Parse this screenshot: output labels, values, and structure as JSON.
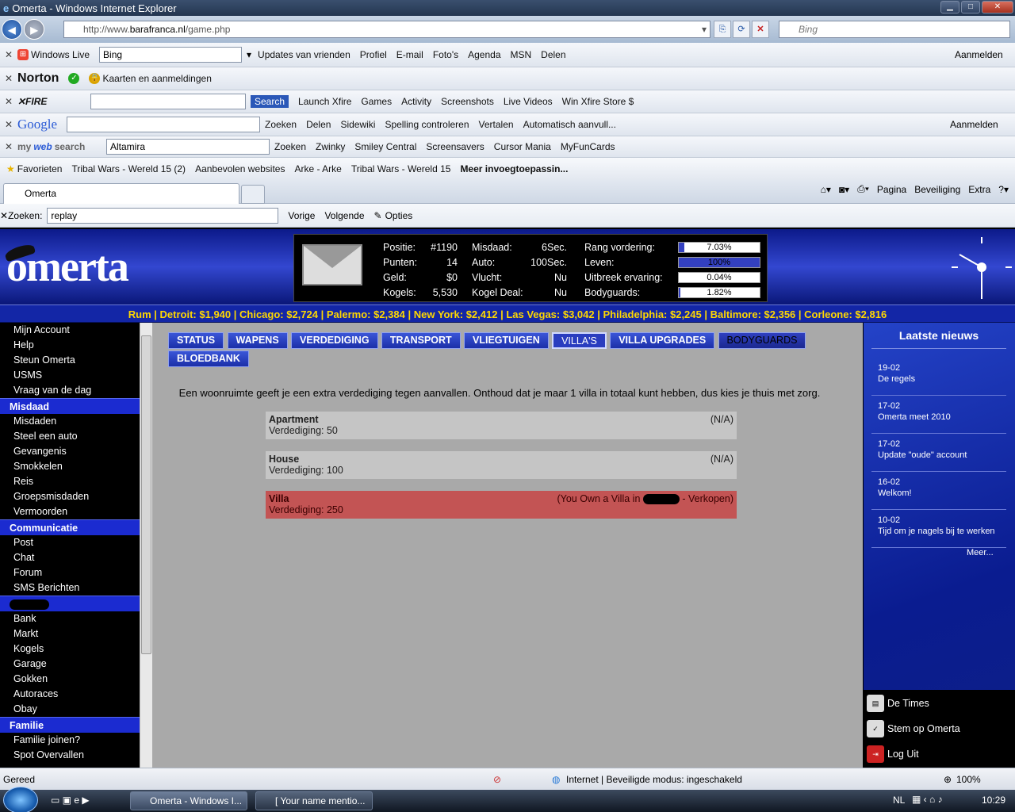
{
  "window": {
    "title": "Omerta - Windows Internet Explorer",
    "min": "▁",
    "max": "□",
    "close": "✕"
  },
  "address": {
    "url_prefix": "http://www.",
    "url_domain": "barafranca.nl",
    "url_path": "/game.php",
    "search_placeholder": "Bing"
  },
  "toolbars": {
    "windows_live": {
      "brand": "Windows Live",
      "search_value": "Bing",
      "items": [
        "Updates van vrienden",
        "Profiel",
        "E-mail",
        "Foto's",
        "Agenda",
        "MSN",
        "Delen"
      ],
      "signin": "Aanmelden"
    },
    "norton": {
      "brand": "Norton",
      "cards": "Kaarten en aanmeldingen"
    },
    "xfire": {
      "search": "Search",
      "items": [
        "Launch Xfire",
        "Games",
        "Activity",
        "Screenshots",
        "Live Videos",
        "Win Xfire Store $"
      ]
    },
    "google": {
      "brand": "Google",
      "items": [
        "Zoeken",
        "Delen",
        "Sidewiki",
        "Spelling controleren",
        "Vertalen",
        "Automatisch aanvull..."
      ],
      "signin": "Aanmelden"
    },
    "mywebsearch": {
      "brand_a": "my",
      "brand_b": "web",
      "brand_c": "search",
      "value": "Altamira",
      "items": [
        "Zoeken",
        "Zwinky",
        "Smiley Central",
        "Screensavers",
        "Cursor Mania",
        "MyFunCards"
      ]
    }
  },
  "favorites": {
    "label": "Favorieten",
    "items": [
      "Tribal Wars - Wereld 15 (2)",
      "Aanbevolen websites",
      "Arke - Arke",
      "Tribal Wars - Wereld 15",
      "Meer invoegtoepassin..."
    ]
  },
  "tab": {
    "title": "Omerta"
  },
  "commandbar": [
    "Pagina",
    "Beveiliging",
    "Extra"
  ],
  "find": {
    "label": "Zoeken:",
    "value": "replay",
    "prev": "Vorige",
    "next": "Volgende",
    "options": "Opties"
  },
  "game": {
    "logo": "omerta",
    "stats": [
      {
        "label": "Positie:",
        "value": "#1190"
      },
      {
        "label": "Punten:",
        "value": "14"
      },
      {
        "label": "Geld:",
        "value": "$0"
      },
      {
        "label": "Kogels:",
        "value": "5,530"
      }
    ],
    "timers": [
      {
        "label": "Misdaad:",
        "value": "6Sec."
      },
      {
        "label": "Auto:",
        "value": "100Sec."
      },
      {
        "label": "Vlucht:",
        "value": "Nu"
      },
      {
        "label": "Kogel Deal:",
        "value": "Nu"
      }
    ],
    "bars": [
      {
        "label": "Rang vordering:",
        "text": "7.03%",
        "fill": 7.03
      },
      {
        "label": "Leven:",
        "text": "100%",
        "fill": 100
      },
      {
        "label": "Uitbreek ervaring:",
        "text": "0.04%",
        "fill": 0.04
      },
      {
        "label": "Bodyguards:",
        "text": "1.82%",
        "fill": 1.82
      }
    ],
    "prices": "Rum | Detroit: $1,940 | Chicago: $2,724 | Palermo: $2,384 | New York: $2,412 | Las Vegas: $3,042 | Philadelphia: $2,245 | Baltimore: $2,356 | Corleone: $2,816",
    "menu": {
      "general": [
        "Mijn Account",
        "Help",
        "Steun Omerta",
        "USMS",
        "Vraag van de dag"
      ],
      "misdaad_title": "Misdaad",
      "misdaad": [
        "Misdaden",
        "Steel een auto",
        "Gevangenis",
        "Smokkelen",
        "Reis",
        "Groepsmisdaden",
        "Vermoorden"
      ],
      "comm_title": "Communicatie",
      "comm": [
        "Post",
        "Chat",
        "Forum",
        "SMS Berichten"
      ],
      "hidden": [
        "Bank",
        "Markt",
        "Kogels",
        "Garage",
        "Gokken",
        "Autoraces",
        "Obay"
      ],
      "familie_title": "Familie",
      "familie": [
        "Familie joinen?",
        "Spot Overvallen"
      ]
    },
    "tabs": [
      "STATUS",
      "WAPENS",
      "VERDEDIGING",
      "TRANSPORT",
      "VLIEGTUIGEN",
      "VILLA'S",
      "VILLA UPGRADES",
      "BODYGUARDS",
      "BLOEDBANK"
    ],
    "intro": "Een woonruimte geeft je een extra verdediging tegen aanvallen. Onthoud dat je maar 1 villa in totaal kunt hebben, dus kies je thuis met zorg.",
    "villas": [
      {
        "name": "Apartment",
        "defense": "Verdediging: 50",
        "status": "(N/A)"
      },
      {
        "name": "House",
        "defense": "Verdediging: 100",
        "status": "(N/A)"
      },
      {
        "name": "Villa",
        "defense": "Verdediging: 250",
        "status_a": "(You Own a Villa in",
        "status_b": " - ",
        "sell": "Verkopen",
        ")": ")"
      }
    ],
    "news": {
      "title": "Laatste nieuws",
      "items": [
        {
          "date": "19-02",
          "text": "De regels"
        },
        {
          "date": "17-02",
          "text": "Omerta meet 2010"
        },
        {
          "date": "17-02",
          "text": "Update \"oude\" account"
        },
        {
          "date": "16-02",
          "text": "Welkom!"
        },
        {
          "date": "10-02",
          "text": "Tijd om je nagels bij te werken"
        }
      ],
      "more": "Meer..."
    },
    "bottom": [
      "De Times",
      "Stem op Omerta",
      "Log Uit"
    ]
  },
  "statusbar": {
    "left": "Gereed",
    "zone": "Internet | Beveiligde modus: ingeschakeld",
    "zoom": "100%"
  },
  "taskbar": {
    "btn1": "Omerta - Windows I...",
    "btn2": "[ Your name mentio...",
    "lang": "NL",
    "time": "10:29"
  }
}
